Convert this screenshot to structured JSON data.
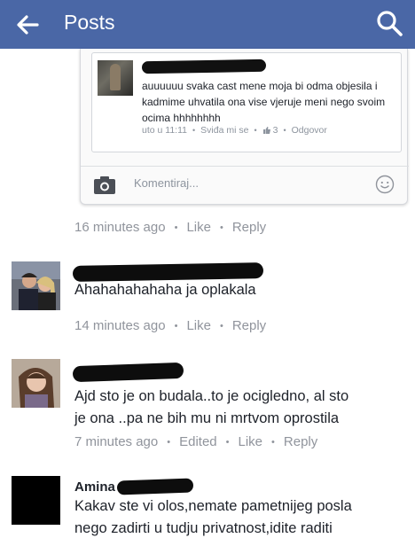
{
  "appbar": {
    "title": "Posts",
    "back_icon": "arrow-left-icon",
    "search_icon": "search-icon",
    "color": "#4a67a6"
  },
  "embedded_reply": {
    "text": "auuuuuu svaka cast mene moja bi odma objesila i kadmime uhvatila ona vise vjeruje meni nego svoim ocima hhhhhhhh",
    "time": "uto u 11:11",
    "like": "Sviđa mi se",
    "like_count": "3",
    "reply": "Odgovor",
    "input_placeholder": "Komentiraj..."
  },
  "post_meta": {
    "time": "16 minutes ago",
    "like": "Like",
    "reply": "Reply"
  },
  "comments": [
    {
      "text": "Ahahahahahaha ja oplakala",
      "time": "14 minutes ago",
      "like": "Like",
      "reply": "Reply"
    },
    {
      "text_line1": "Ajd sto je on budala..to je ocigledno, al sto",
      "text_line2": "je ona ..pa ne bih mu ni mrtvom oprostila",
      "time": "7 minutes ago",
      "edited": "Edited",
      "like": "Like",
      "reply": "Reply"
    },
    {
      "name": "Amina",
      "text_line1": "Kakav ste vi olos,nemate pametnijeg posla",
      "text_line2": "nego zadirti u tudju privatnost,idite raditi"
    }
  ]
}
